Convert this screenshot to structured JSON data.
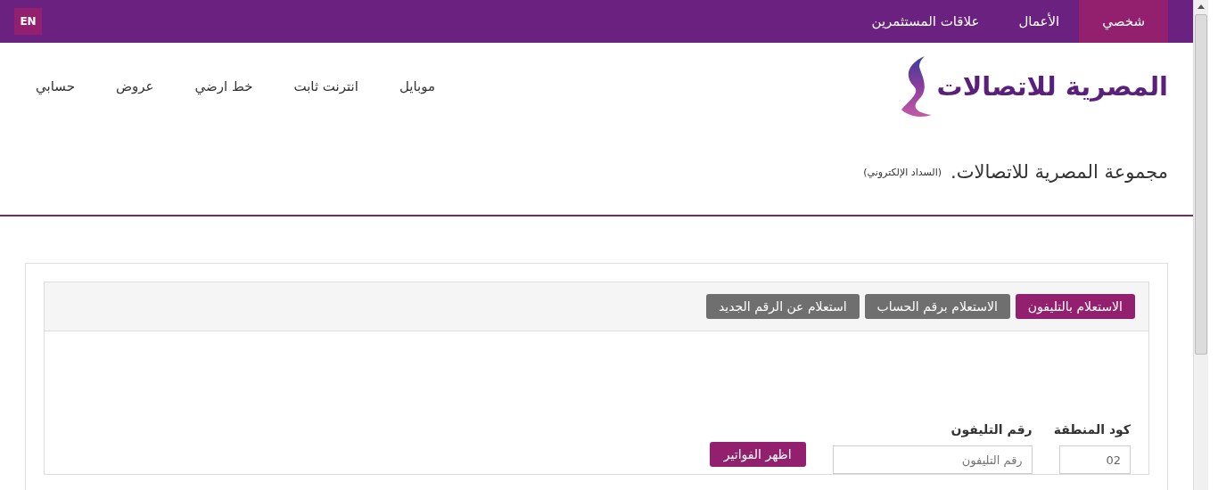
{
  "top_bar": {
    "segments": [
      {
        "label": "شخصي",
        "selected": true
      },
      {
        "label": "الأعمال",
        "selected": false
      },
      {
        "label": "علاقات المستثمرين",
        "selected": false
      }
    ],
    "language_button": "EN"
  },
  "logo": {
    "text": "المصرية للاتصالات"
  },
  "nav": {
    "items": [
      "موبايل",
      "انترنت ثابت",
      "خط ارضي",
      "عروض",
      "حسابي"
    ]
  },
  "page_title": {
    "title": "مجموعة المصرية للاتصالات.",
    "subtitle": "(السداد الإلكتروني)"
  },
  "inquiry": {
    "tabs": [
      {
        "label": "الاستعلام بالتليفون",
        "selected": true
      },
      {
        "label": "الاستعلام برقم الحساب",
        "selected": false
      },
      {
        "label": "استعلام عن الرقم الجديد",
        "selected": false
      }
    ],
    "fields": [
      {
        "label": "كود المنطقة",
        "value": "02"
      },
      {
        "label": "رقم التليفون",
        "placeholder": "رقم التليفون"
      }
    ],
    "submit": "اظهر الفواتير"
  }
}
